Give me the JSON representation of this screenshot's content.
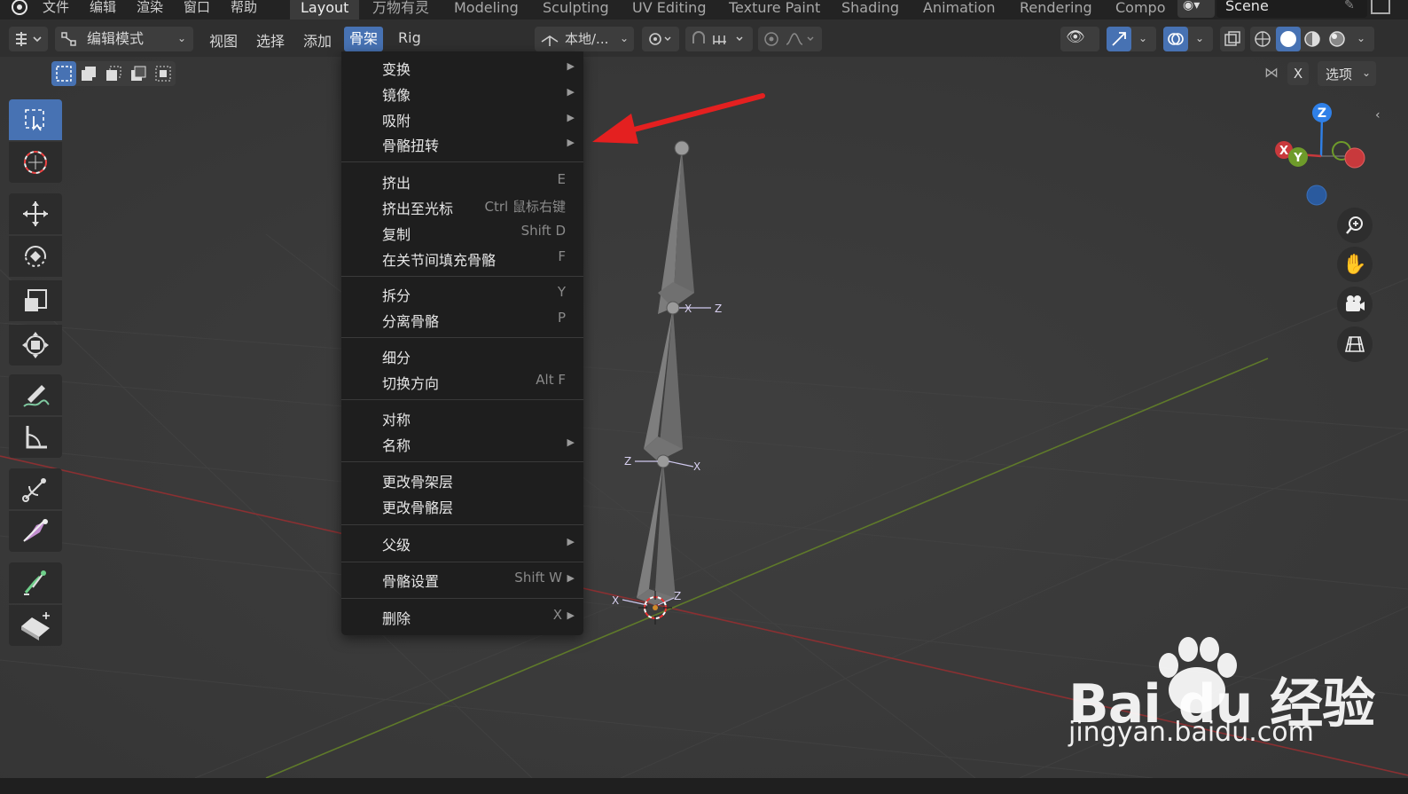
{
  "top_menu": {
    "file": "文件",
    "edit": "编辑",
    "render": "渲染",
    "window": "窗口",
    "help": "帮助"
  },
  "workspaces": [
    "Layout",
    "万物有灵",
    "Modeling",
    "Sculpting",
    "UV Editing",
    "Texture Paint",
    "Shading",
    "Animation",
    "Rendering",
    "Compo"
  ],
  "active_workspace": "Layout",
  "scene": {
    "label": "Scene"
  },
  "header": {
    "mode": "编辑模式",
    "menus": [
      "视图",
      "选择",
      "添加",
      "骨架",
      "Rig"
    ],
    "active_menu": "骨架",
    "pivot": "本地/...",
    "options": "选项",
    "x_axis": "X"
  },
  "armature_menu": {
    "items": [
      {
        "label": "变换",
        "shortcut": "",
        "submenu": true
      },
      {
        "label": "镜像",
        "shortcut": "",
        "submenu": true
      },
      {
        "label": "吸附",
        "shortcut": "",
        "submenu": true
      },
      {
        "label": "骨骼扭转",
        "shortcut": "",
        "submenu": true,
        "highlighted": true
      },
      {
        "label": "挤出",
        "shortcut": "E",
        "submenu": false
      },
      {
        "label": "挤出至光标",
        "shortcut": "Ctrl 鼠标右键",
        "submenu": false
      },
      {
        "label": "复制",
        "shortcut": "Shift D",
        "submenu": false
      },
      {
        "label": "在关节间填充骨骼",
        "shortcut": "F",
        "submenu": false
      },
      {
        "label": "拆分",
        "shortcut": "Y",
        "submenu": false
      },
      {
        "label": "分离骨骼",
        "shortcut": "P",
        "submenu": false
      },
      {
        "label": "细分",
        "shortcut": "",
        "submenu": false
      },
      {
        "label": "切换方向",
        "shortcut": "Alt F",
        "submenu": false
      },
      {
        "label": "对称",
        "shortcut": "",
        "submenu": false
      },
      {
        "label": "名称",
        "shortcut": "",
        "submenu": true
      },
      {
        "label": "更改骨架层",
        "shortcut": "",
        "submenu": false
      },
      {
        "label": "更改骨骼层",
        "shortcut": "",
        "submenu": false
      },
      {
        "label": "父级",
        "shortcut": "",
        "submenu": true
      },
      {
        "label": "骨骼设置",
        "shortcut": "Shift W",
        "submenu": true
      },
      {
        "label": "删除",
        "shortcut": "X",
        "submenu": true
      }
    ]
  },
  "gizmo": {
    "z": "Z",
    "x": "X",
    "y": "Y"
  },
  "bone_axes": {
    "x": "X",
    "z": "Z"
  },
  "watermark": {
    "logo": "Bai du 经验",
    "url": "jingyan.baidu.com"
  },
  "icons": {
    "blender": "blender-logo-icon",
    "select_box": "select-box-icon",
    "cursor": "cursor-icon",
    "move": "move-icon",
    "rotate": "rotate-icon",
    "scale": "scale-icon",
    "transform": "transform-icon",
    "annotate": "annotate-icon",
    "measure": "measure-icon",
    "roll": "bone-roll-icon",
    "bone_size": "bone-size-icon",
    "extrude": "extrude-icon",
    "envelope": "envelope-icon"
  },
  "colors": {
    "accent": "#4772b3",
    "highlight_box": "#e22222",
    "arrow": "#e42020",
    "x_axis": "#c8393c",
    "y_axis": "#6e9b2a",
    "z_axis": "#2f80e8"
  }
}
